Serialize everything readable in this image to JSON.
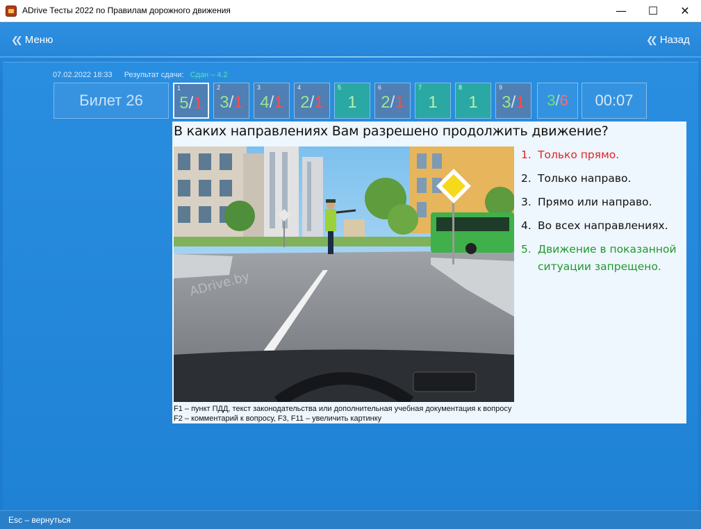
{
  "window": {
    "title": "ADrive Тесты 2022 по Правилам дорожного движения",
    "min_glyph": "—",
    "max_glyph": "☐",
    "close_glyph": "✕"
  },
  "nav": {
    "menu_label": "Меню",
    "back_label": "Назад"
  },
  "meta": {
    "datetime": "07.02.2022 18:33",
    "result_label": "Результат сдачи:",
    "result_value": "Сдан – 4.2"
  },
  "ticket": {
    "label": "Билет 26"
  },
  "questions": [
    {
      "n": "1",
      "a": "5",
      "sep": "/",
      "b": "1",
      "state": "gray",
      "active": true
    },
    {
      "n": "2",
      "a": "3",
      "sep": "/",
      "b": "1",
      "state": "gray"
    },
    {
      "n": "3",
      "a": "4",
      "sep": "/",
      "b": "1",
      "state": "gray"
    },
    {
      "n": "4",
      "a": "2",
      "sep": "/",
      "b": "1",
      "state": "gray"
    },
    {
      "n": "5",
      "one": "1",
      "state": "teal"
    },
    {
      "n": "6",
      "a": "2",
      "sep": "/",
      "b": "1",
      "state": "gray"
    },
    {
      "n": "7",
      "one": "1",
      "state": "teal"
    },
    {
      "n": "8",
      "one": "1",
      "state": "teal"
    },
    {
      "n": "9",
      "a": "3",
      "sep": "/",
      "b": "1",
      "state": "gray"
    }
  ],
  "score": {
    "right": "3",
    "sep": "/",
    "wrong": "6"
  },
  "timer": {
    "value": "00:07"
  },
  "question": {
    "text": "В каких направлениях Вам разрешено продолжить движение?",
    "watermark": "ADrive.by",
    "answers": [
      {
        "num": "1.",
        "text": "Только прямо.",
        "state": "wrong"
      },
      {
        "num": "2.",
        "text": "Только направо.",
        "state": "normal"
      },
      {
        "num": "3.",
        "text": "Прямо или направо.",
        "state": "normal"
      },
      {
        "num": "4.",
        "text": "Во всех направлениях.",
        "state": "normal"
      },
      {
        "num": "5.",
        "text": "Движение в показанной ситуации запрещено.",
        "state": "correct"
      }
    ],
    "hint1": "F1 – пункт ПДД, текст законодательства или дополнительная учебная документация к вопросу",
    "hint2": "F2 – комментарий к вопросу,   F3, F11 – увеличить картинку"
  },
  "status": {
    "text": "Esc – вернуться"
  },
  "colors": {
    "wrong": "#e32323",
    "correct": "#1f9a2a",
    "teal": "#2aa8a4",
    "gray": "#4f7fb3"
  }
}
